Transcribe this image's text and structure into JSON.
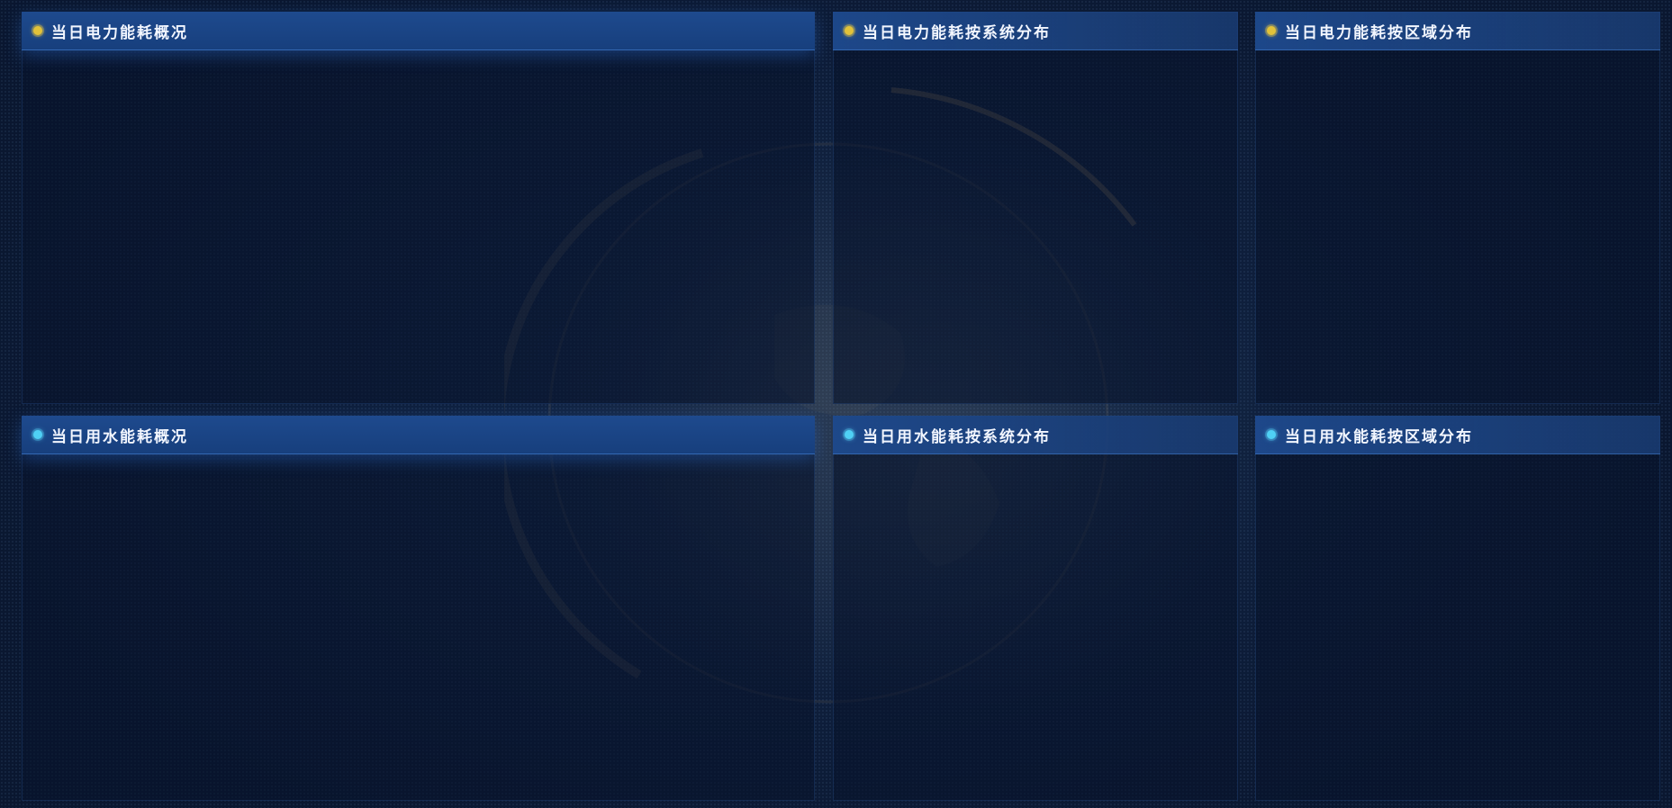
{
  "panels": [
    {
      "title": "当日电力能耗概况",
      "dot_color": "yellow"
    },
    {
      "title": "当日电力能耗按系统分布",
      "dot_color": "yellow"
    },
    {
      "title": "当日电力能耗按区域分布",
      "dot_color": "yellow"
    },
    {
      "title": "当日用水能耗概况",
      "dot_color": "cyan"
    },
    {
      "title": "当日用水能耗按系统分布",
      "dot_color": "cyan"
    },
    {
      "title": "当日用水能耗按区域分布",
      "dot_color": "cyan"
    }
  ],
  "colors": {
    "background": "#0b1a33",
    "header": "#1e4a8e",
    "electric_dot": "#e2c23a",
    "water_dot": "#4fd0f5",
    "title_text": "#f2f6ff"
  }
}
